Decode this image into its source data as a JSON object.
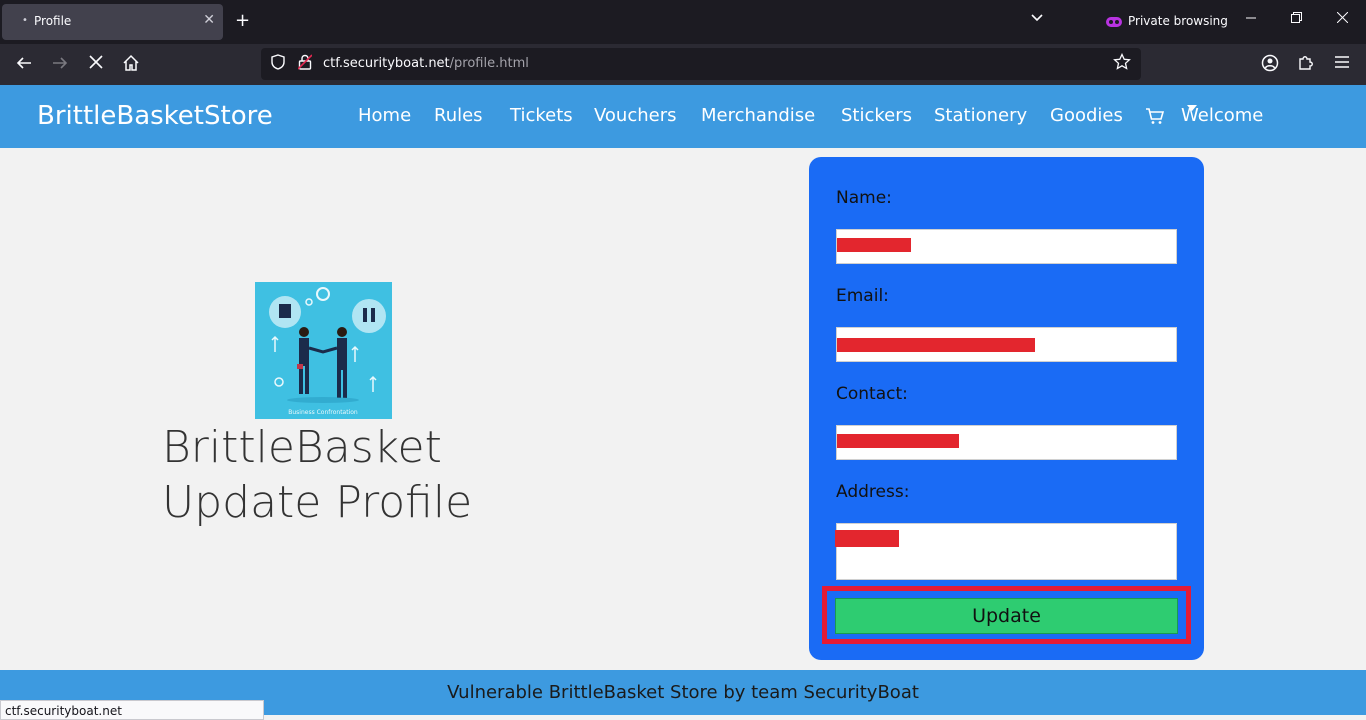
{
  "browser": {
    "tab_title": "Profile",
    "tab_dot": "•",
    "close_glyph": "✕",
    "new_tab_glyph": "+",
    "list_tabs_glyph": "⌄",
    "private_label": "Private browsing",
    "url_host": "ctf.securityboat.net",
    "url_path": "/profile.html",
    "status_text": "ctf.securityboat.net"
  },
  "site": {
    "brand": "BrittleBasketStore",
    "nav": {
      "home": "Home",
      "rules": "Rules",
      "tickets": "Tickets",
      "vouchers": "Vouchers",
      "merchandise": "Merchandise",
      "stickers": "Stickers",
      "stationery": "Stationery",
      "goodies": "Goodies",
      "welcome": "Welcome"
    },
    "accent_color": "#3d9ae0",
    "card_color": "#1a6bf5",
    "button_color": "#2ecc71"
  },
  "main": {
    "heading_line1": "BrittleBasket",
    "heading_line2": "Update Profile",
    "illustration_caption": "Business Confrontation"
  },
  "form": {
    "name_label": "Name:",
    "email_label": "Email:",
    "contact_label": "Contact:",
    "address_label": "Address:",
    "update_label": "Update"
  },
  "footer": {
    "text": "Vulnerable BrittleBasket Store by team SecurityBoat"
  }
}
